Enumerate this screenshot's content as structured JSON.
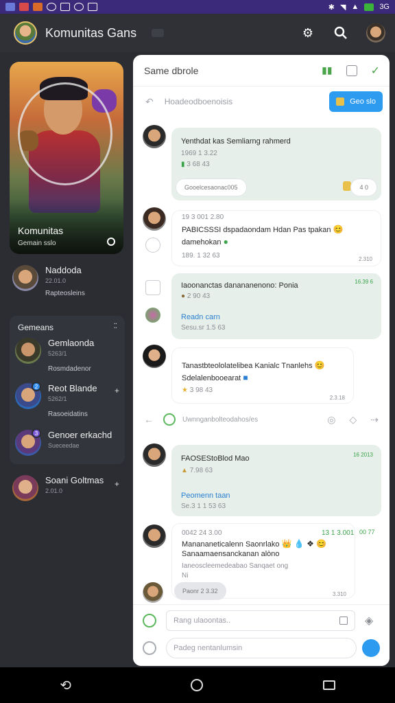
{
  "statusbar": {
    "network": "3G"
  },
  "header": {
    "title": "Komunitas Gans"
  },
  "hero": {
    "title": "Komunitas",
    "subtitle": "Gemain sslo"
  },
  "sidebar": {
    "user": {
      "name": "Naddoda",
      "meta": "22.01.0",
      "status": "Rapteosleins"
    },
    "group": {
      "heading": "Gemeans",
      "items": [
        {
          "name": "Gemlaonda",
          "meta": "5263/1",
          "status": "Rosmdadenor"
        },
        {
          "name": "Reot Blande",
          "meta": "5262/1",
          "status": "Rasoeidatins"
        },
        {
          "name": "Genoer erkachd",
          "meta": "Sueceedae"
        }
      ]
    },
    "extra": {
      "name": "Soani Goltmas",
      "meta": "2.01.0"
    }
  },
  "panel": {
    "title": "Same dbrole",
    "subheader": {
      "text": "Hoadeodboenoisis",
      "button": "Geo slo"
    },
    "messages": [
      {
        "line1": "Yenthdat kas Semliarng rahmerd",
        "line2": "1969 1 3.22",
        "line3": "3 68 43",
        "pill": "Gooelcesaonac005",
        "chip": "4 0"
      },
      {
        "meta": "19 3 001 2.80",
        "line1": "PABICSSSI dspadaondam Hdan Pas tpakan",
        "line2": "damehokan",
        "sub": "189. 1 32 63",
        "ts": "2.310"
      },
      {
        "line1": "Iaoonanctas danananenono: Ponia",
        "line2": "2 90 43",
        "ts": "16.39 6",
        "link": "Readn carn",
        "sub": "Sesu.sr 1.5 63"
      },
      {
        "line1": "Tanastbteololatelibea Kanialc Tnanlehs",
        "line2": "Sdelalenbooearat",
        "line3": "3 98 43",
        "ts": "2.3.18"
      },
      {
        "line1": "FAOSEStoBlod Mao",
        "line2": "7.98 63",
        "ts": "16 2013",
        "link": "Peomenn taan",
        "sub": "Se.3 1 1 53 63"
      },
      {
        "meta": "0042 24 3.00",
        "meta2": "13 1 3.001",
        "meta3": "00 77",
        "line1": "Manananeticalenn Saonrlako",
        "line2": "Sanaamaensanckanan alòno",
        "line3": "Ianeoscleemedeabao Sanqaet ong",
        "line4": "Ni",
        "ts": "3.310",
        "pill": "Paonr 2 3.32"
      }
    ],
    "divider": {
      "text": "Uwnnganbolteodahos/es"
    },
    "composer": {
      "placeholder1": "Rang ulaoontas..",
      "placeholder2": "Padeg nentanlumsin"
    }
  }
}
